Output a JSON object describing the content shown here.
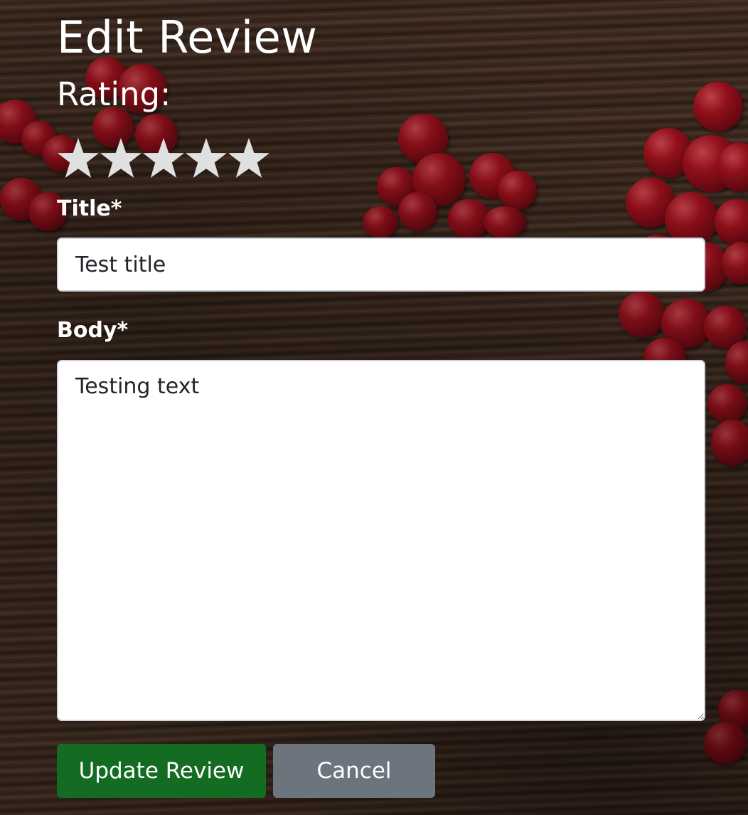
{
  "page": {
    "title": "Edit Review"
  },
  "rating": {
    "label": "Rating:",
    "max": 5,
    "value": 0,
    "star_color": "#e0e0e0"
  },
  "form": {
    "title_label": "Title*",
    "title_value": "Test title",
    "body_label": "Body*",
    "body_value": "Testing text"
  },
  "actions": {
    "update_label": "Update Review",
    "update_color": "#146c23",
    "cancel_label": "Cancel",
    "cancel_color": "#6c757d"
  }
}
